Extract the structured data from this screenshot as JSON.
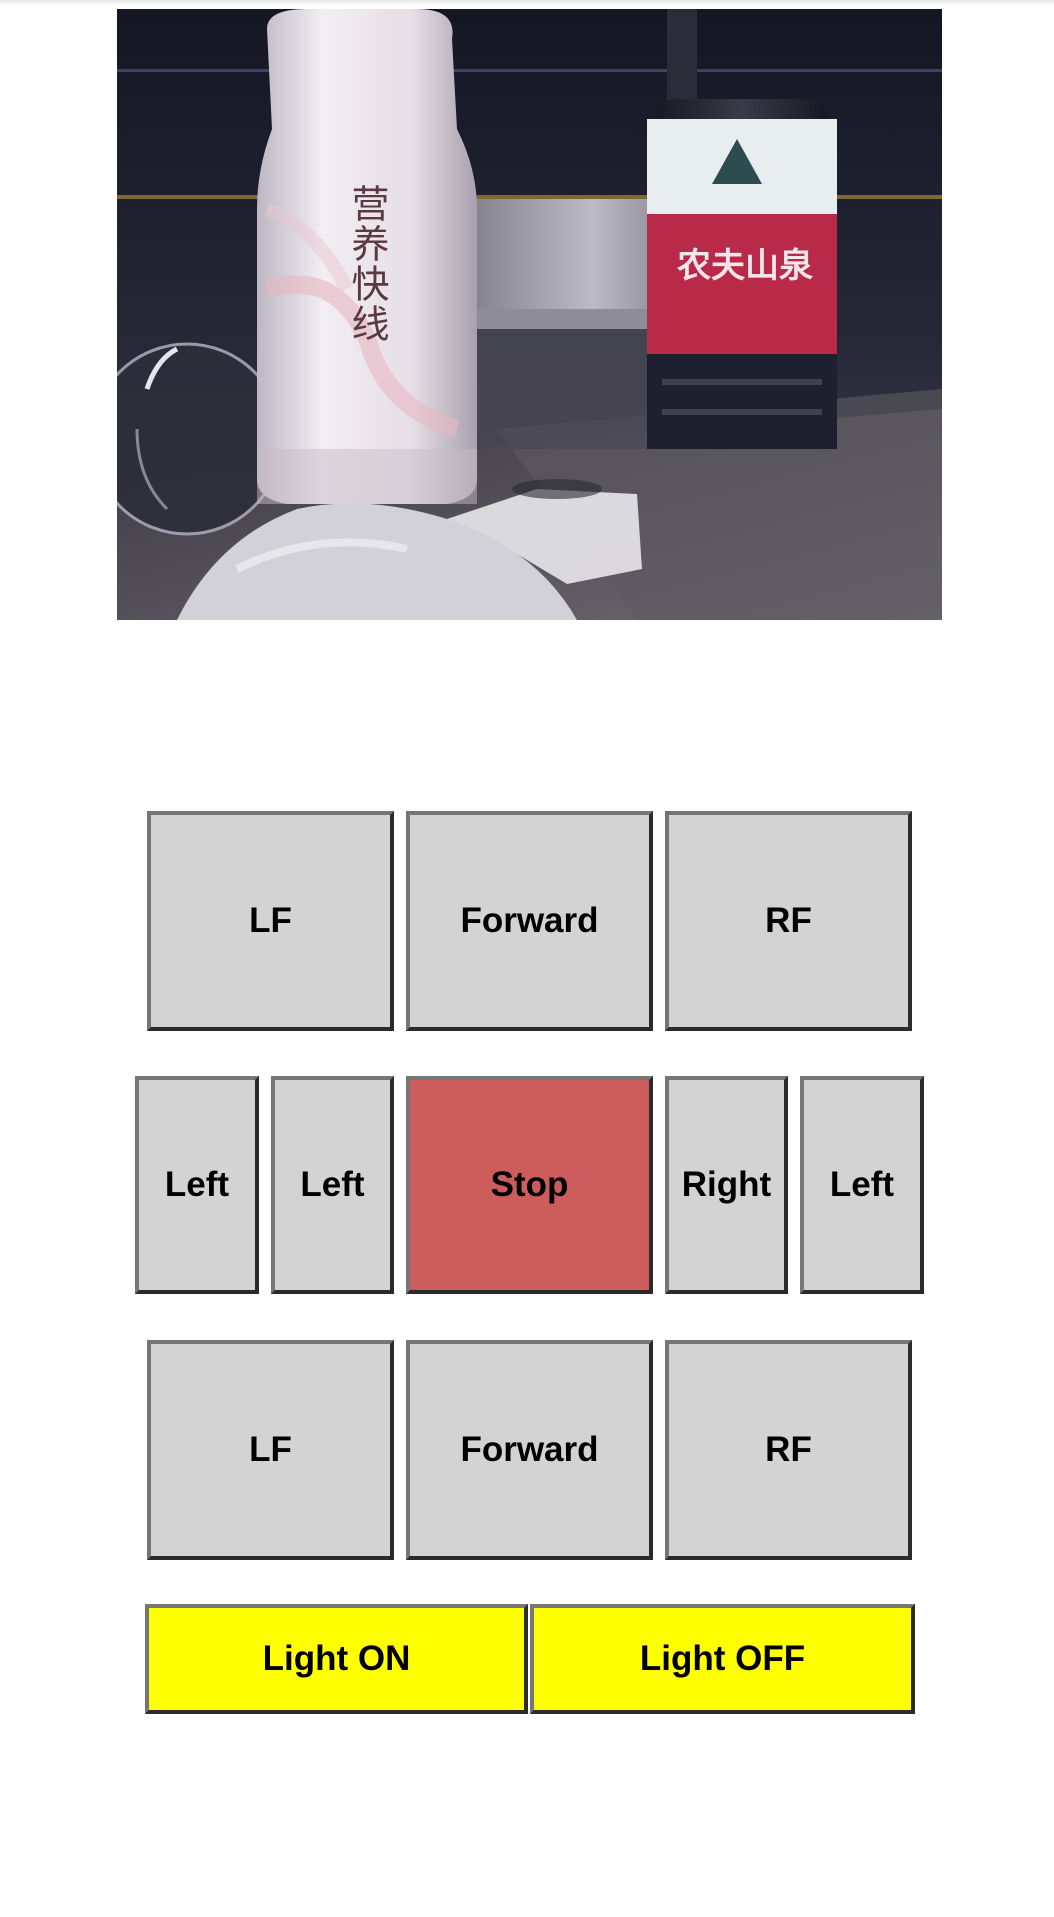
{
  "camera": {
    "bottle_left_label": "营养快线",
    "bottle_right_label": "农夫山泉"
  },
  "controls": {
    "row1": [
      "LF",
      "Forward",
      "RF"
    ],
    "row2": [
      "Left",
      "Left",
      "Stop",
      "Right",
      "Left"
    ],
    "row3": [
      "LF",
      "Forward",
      "RF"
    ],
    "lights": [
      "Light ON",
      "Light OFF"
    ]
  },
  "colors": {
    "button_bg": "#d3d3d3",
    "stop_bg": "#cd5c5c",
    "light_bg": "#ffff00"
  }
}
